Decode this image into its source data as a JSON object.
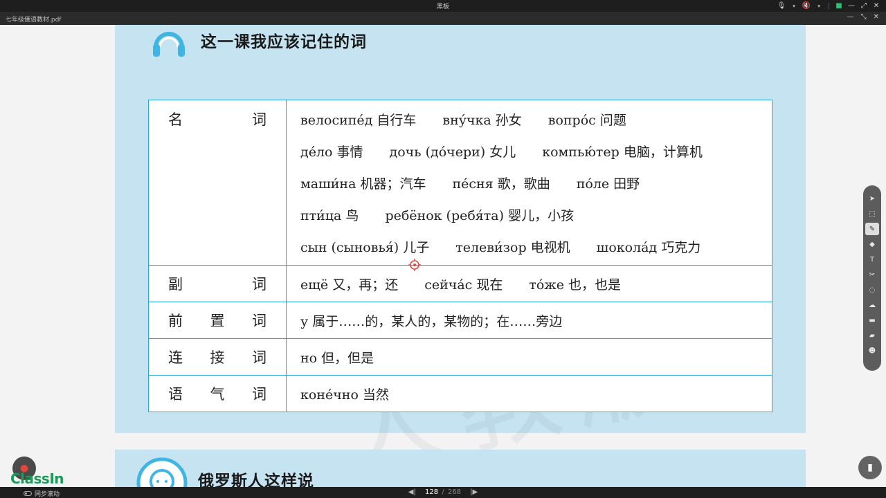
{
  "window": {
    "title": "黑板",
    "colors": {
      "bar": "#1e1e1e",
      "accent": "#2fbf71",
      "table_border": "#2aa6d8",
      "page_bg": "#c6e3f2"
    },
    "icons": [
      "mic-icon",
      "speaker-icon",
      "camera-icon",
      "minimize-icon",
      "maximize-icon",
      "close-icon"
    ]
  },
  "document": {
    "filename": "七年级俄语教材.pdf",
    "page_icons": [
      "minimize-icon",
      "restore-icon",
      "close-icon"
    ]
  },
  "page": {
    "title": "这一课我应该记住的词",
    "next_section_title": "俄罗斯人这样说",
    "watermark": "人教版",
    "vocab": [
      {
        "category": [
          "名",
          "词"
        ],
        "lines": [
          [
            "велосипе́д 自行车",
            "вну́чка 孙女",
            "вопро́с 问题"
          ],
          [
            "де́ло 事情",
            "дочь (до́чери) 女儿",
            "компью́тер 电脑，计算机"
          ],
          [
            "маши́на 机器；汽车",
            "пе́сня 歌，歌曲",
            "по́ле 田野"
          ],
          [
            "пти́ца 鸟",
            "ребёнок (ребя́та) 婴儿，小孩"
          ],
          [
            "сын (сыновья́) 儿子",
            "телеви́зор 电视机",
            "шокола́д 巧克力"
          ]
        ]
      },
      {
        "category": [
          "副",
          "词"
        ],
        "lines": [
          [
            "ещё 又，再；还",
            "сейча́с 现在",
            "то́же 也，也是"
          ]
        ]
      },
      {
        "category": [
          "前",
          "置",
          "词"
        ],
        "lines": [
          [
            "у 属于……的，某人的，某物的；在……旁边"
          ]
        ]
      },
      {
        "category": [
          "连",
          "接",
          "词"
        ],
        "lines": [
          [
            "но 但，但是"
          ]
        ]
      },
      {
        "category": [
          "语",
          "气",
          "词"
        ],
        "lines": [
          [
            "коне́чно 当然"
          ]
        ]
      }
    ]
  },
  "toolbar": {
    "tools": [
      "pointer-icon",
      "select-icon",
      "pen-icon",
      "highlighter-icon",
      "text-icon",
      "scissors-icon",
      "eraser-icon",
      "cloud-icon",
      "folder-icon",
      "chat-icon",
      "users-icon"
    ],
    "active_index": 2
  },
  "branding": {
    "logo": "ClassIn"
  },
  "status": {
    "sync_label": "同步滚动",
    "current_page": "128",
    "separator": "/",
    "total_pages": "268"
  }
}
